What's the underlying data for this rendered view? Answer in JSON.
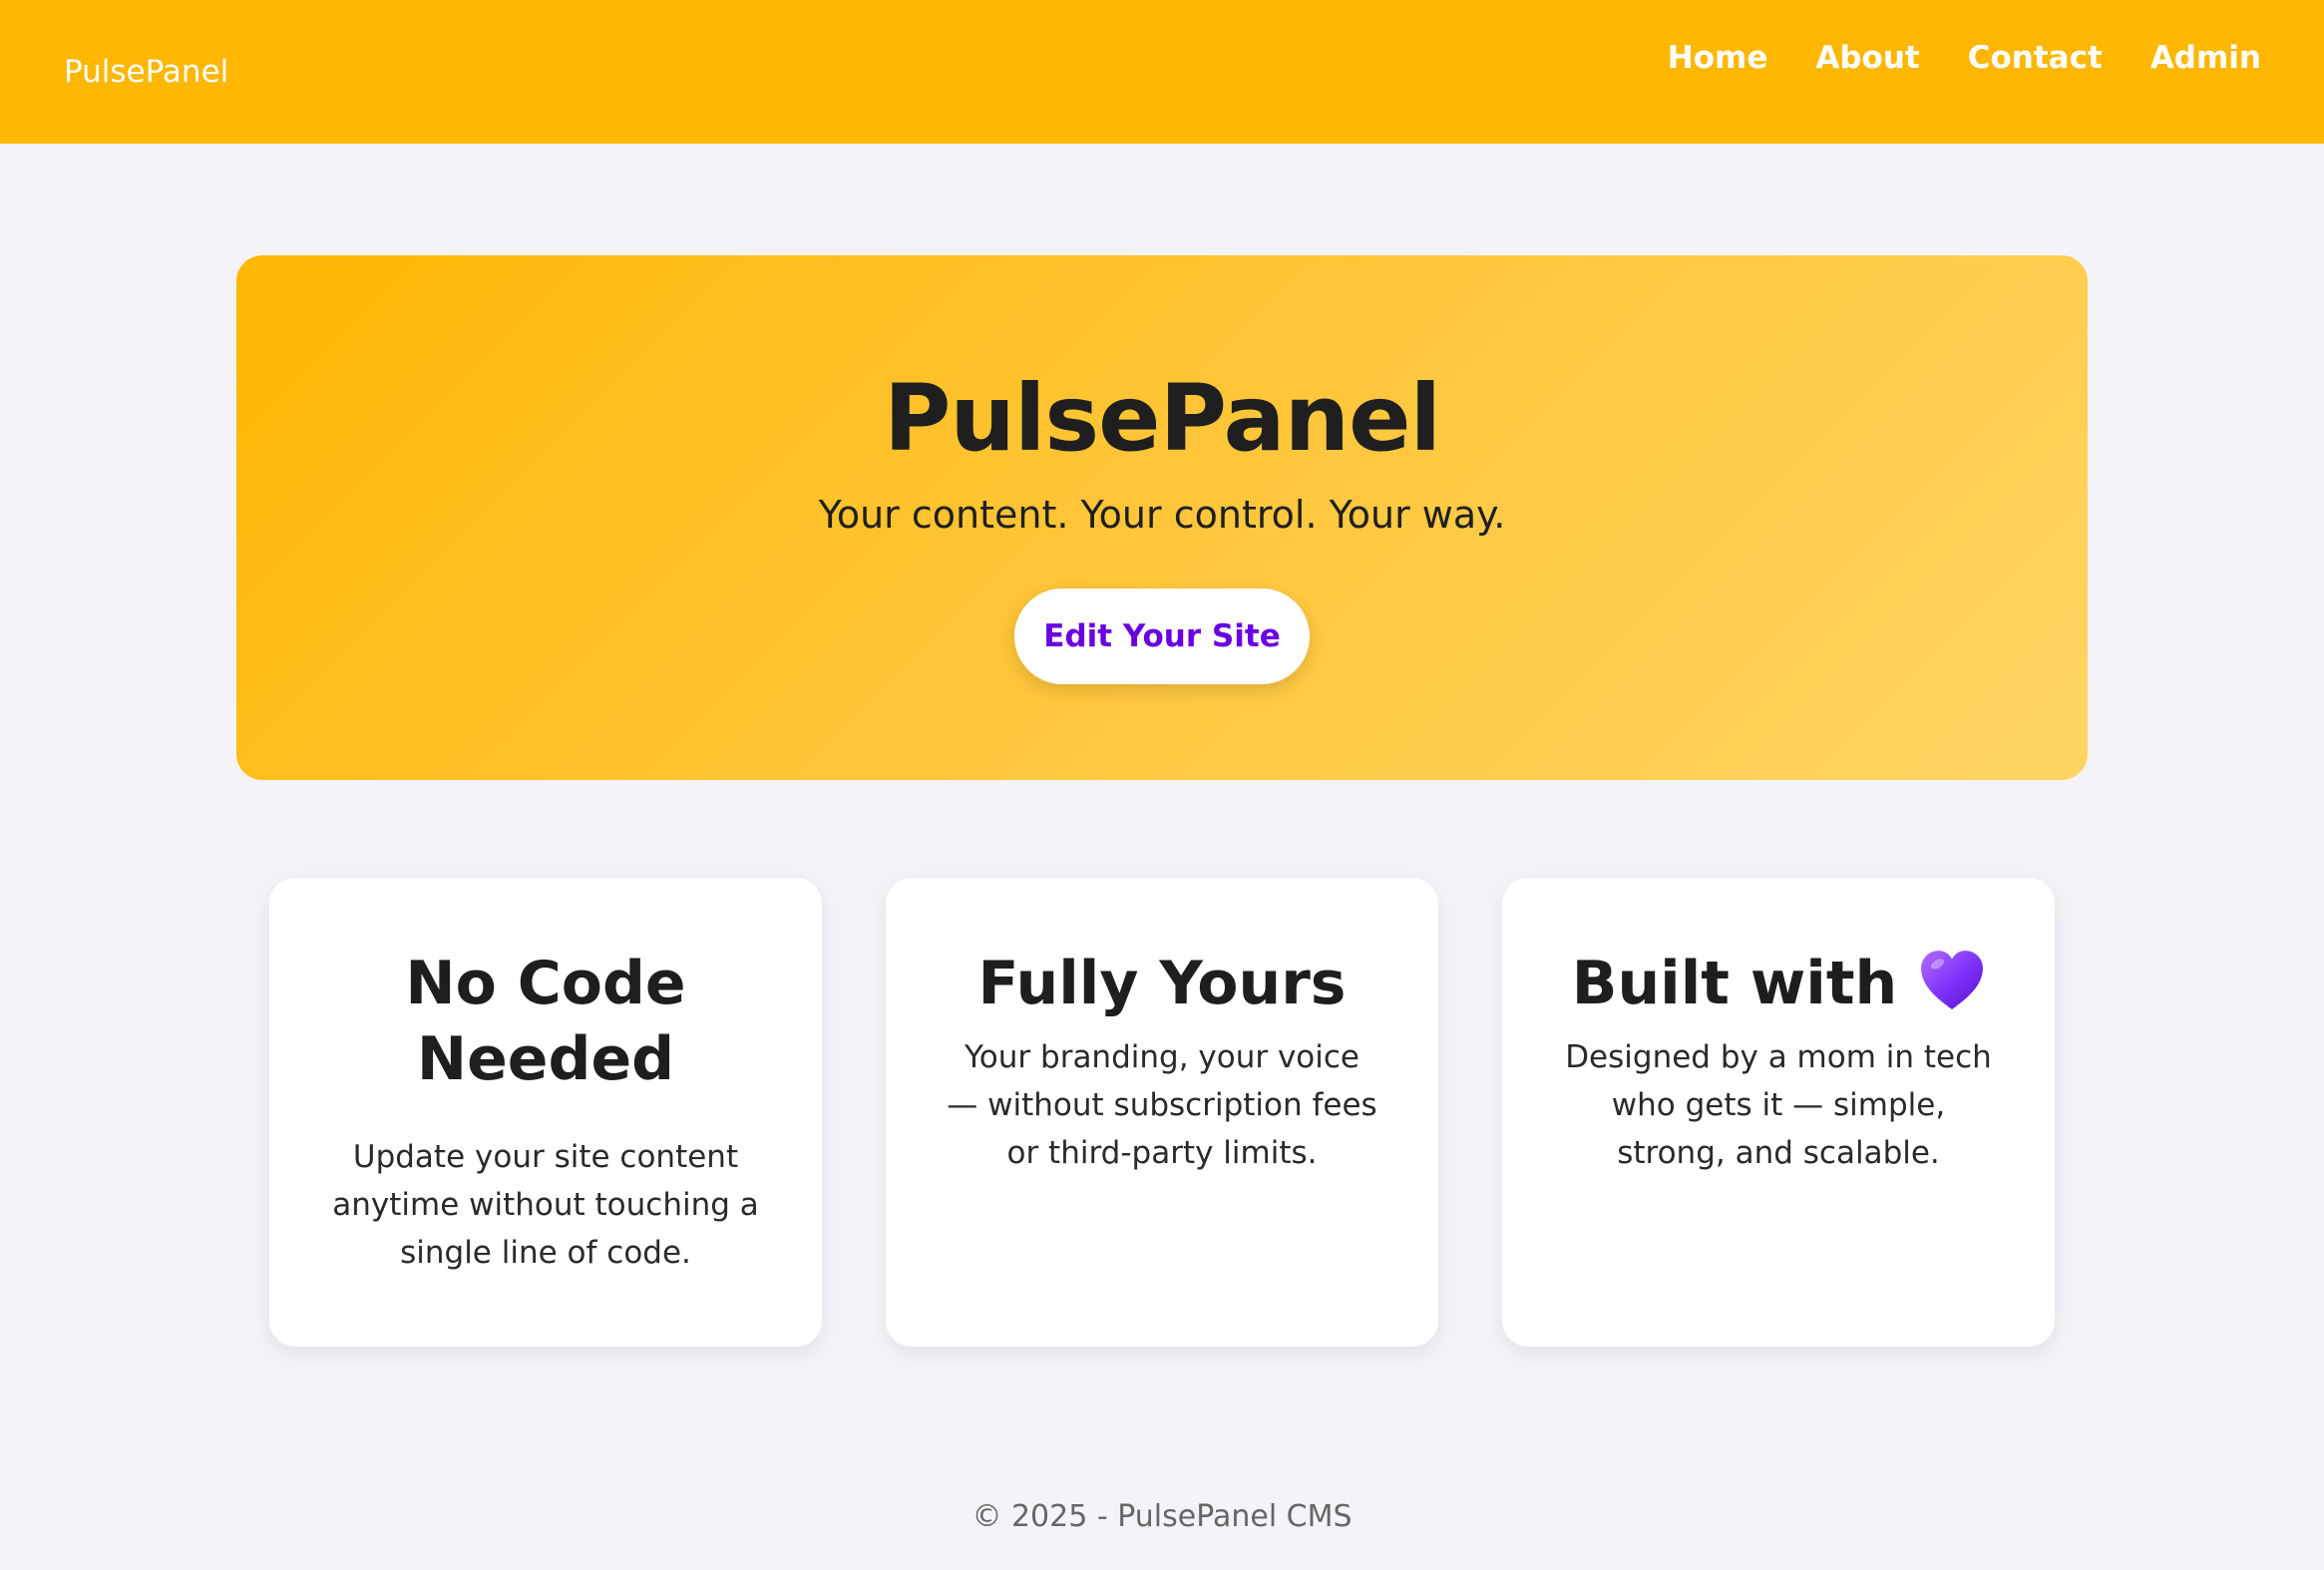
{
  "header": {
    "brand": "PulsePanel",
    "nav": [
      "Home",
      "About",
      "Contact",
      "Admin"
    ]
  },
  "hero": {
    "title": "PulsePanel",
    "tagline": "Your content. Your control. Your way.",
    "cta_label": "Edit Your Site"
  },
  "features": [
    {
      "title": "No Code Needed",
      "text": "Update your site content anytime without touching a single line of code."
    },
    {
      "title": "Fully Yours",
      "text": "Your branding, your voice — without subscription fees or third-party limits."
    },
    {
      "title": "Built with",
      "icon": "purple-heart-icon",
      "text": "Designed by a mom in tech who gets it — simple, strong, and scalable."
    }
  ],
  "footer": {
    "text": "© 2025 - PulsePanel CMS"
  },
  "colors": {
    "accent": "#ffb703",
    "cta_text": "#6a00e0",
    "background": "#f4f3f8",
    "heart": "#7b2ff7"
  }
}
